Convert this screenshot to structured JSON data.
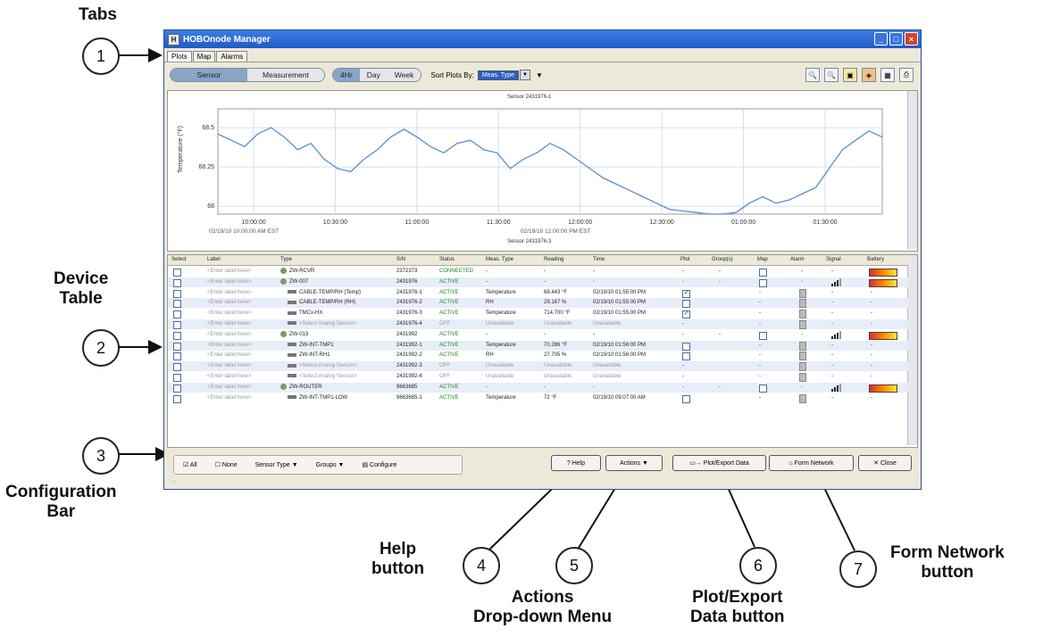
{
  "annotations": {
    "tabs_title": "Tabs",
    "device_table_title": "Device\nTable",
    "config_bar_title": "Configuration\nBar",
    "help_title": "Help\nbutton",
    "actions_title": "Actions\nDrop-down Menu",
    "plot_export_title": "Plot/Export\nData button",
    "form_network_title": "Form Network\nbutton",
    "callouts": [
      "1",
      "2",
      "3",
      "4",
      "5",
      "6",
      "7"
    ]
  },
  "window": {
    "title": "HOBOnode Manager",
    "icon_letter": "H",
    "controls": [
      "_",
      "□",
      "×"
    ]
  },
  "tabs": [
    "Plots",
    "Map",
    "Alarms"
  ],
  "toolbar": {
    "view_segment": [
      "Sensor",
      "Measurement"
    ],
    "range_segment": [
      "4Hr",
      "Day",
      "Week"
    ],
    "sort_label": "Sort Plots By:",
    "sort_value": "Meas. Type",
    "icons": [
      "zoom-in-icon",
      "zoom-out-icon",
      "export-icon",
      "refresh-icon",
      "grid-icon",
      "print-icon"
    ]
  },
  "plot": {
    "sensor_title_top": "Sensor 2431976-1",
    "sensor_title_bottom": "Sensor 2431976-3",
    "ylabel": "Temperature (°F)",
    "yticks": [
      "68.5",
      "68.25",
      "68"
    ],
    "xticks": [
      "10:00:00",
      "10:30:00",
      "11:00:00",
      "11:30:00",
      "12:00:00",
      "12:30:00",
      "01:00:00",
      "01:30:00"
    ],
    "date_left": "02/19/10 10:00:00 AM EST",
    "date_mid": "02/19/10 12:00:00 PM EST",
    "line_color": "#5b8ad9"
  },
  "chart_data": {
    "type": "line",
    "ylabel": "Temperature (°F)",
    "ylim": [
      67.95,
      68.62
    ],
    "x": [
      0,
      2,
      4,
      6,
      8,
      10,
      12,
      14,
      16,
      18,
      20,
      22,
      24,
      26,
      28,
      30,
      32,
      34,
      36,
      38,
      40,
      42,
      44,
      46,
      48,
      50,
      52,
      54,
      56,
      58,
      60,
      62,
      64,
      66,
      68,
      70,
      72,
      74,
      76,
      78,
      80,
      82,
      84,
      86,
      88,
      90,
      92,
      94,
      96,
      98,
      100
    ],
    "series": [
      {
        "values": [
          68.46,
          68.42,
          68.38,
          68.46,
          68.5,
          68.44,
          68.36,
          68.4,
          68.3,
          68.24,
          68.22,
          68.3,
          68.36,
          68.44,
          68.49,
          68.44,
          68.38,
          68.34,
          68.4,
          68.42,
          68.36,
          68.34,
          68.24,
          68.3,
          68.34,
          68.4,
          68.36,
          68.3,
          68.24,
          68.18,
          68.14,
          68.1,
          68.06,
          68.02,
          67.98,
          67.97,
          67.96,
          67.95,
          67.95,
          67.96,
          68.02,
          68.06,
          68.02,
          68.04,
          68.08,
          68.12,
          68.24,
          68.36,
          68.42,
          68.48,
          68.44
        ]
      }
    ]
  },
  "device_table": {
    "columns": [
      "Select",
      "Label",
      "Type",
      "S/N",
      "Status",
      "Meas. Type",
      "Reading",
      "Time",
      "Plot",
      "Group(s)",
      "Map",
      "Alarm",
      "Signal",
      "Battery"
    ],
    "rows": [
      {
        "label": "<Enter label here>",
        "type": "ZW-RCVR",
        "sn": "2372373",
        "status": "CONNECTED",
        "meas": "-",
        "reading": "-",
        "time": "-",
        "plot": "-",
        "groups": "-",
        "map": "box",
        "alarm": "-",
        "signal": "-",
        "battery": "yes"
      },
      {
        "label": "<Enter label here>",
        "type": "ZW-007",
        "sn": "2431976",
        "status": "ACTIVE",
        "meas": "-",
        "reading": "-",
        "time": "-",
        "plot": "-",
        "groups": "-",
        "map": "box",
        "alarm": "-",
        "signal": "bars",
        "battery": "yes"
      },
      {
        "label": "<Enter label here>",
        "type": "CABLE-TEMP/RH (Temp)",
        "sn": "2431976-1",
        "status": "ACTIVE",
        "meas": "Temperature",
        "reading": "68.443 °F",
        "time": "02/19/10 01:55:00 PM",
        "plot": "checked",
        "groups": "",
        "map": "-",
        "alarm": "icon",
        "signal": "-",
        "battery": "-"
      },
      {
        "label": "<Enter label here>",
        "type": "CABLE-TEMP/RH (RH)",
        "sn": "2431976-2",
        "status": "ACTIVE",
        "meas": "RH",
        "reading": "29.167 %",
        "time": "02/19/10 01:55:00 PM",
        "plot": "box",
        "groups": "",
        "map": "-",
        "alarm": "icon",
        "signal": "-",
        "battery": "-"
      },
      {
        "label": "<Enter label here>",
        "type": "TMCx-HX",
        "sn": "2431976-3",
        "status": "ACTIVE",
        "meas": "Temperature",
        "reading": "714.700 °F",
        "time": "02/19/10 01:55:00 PM",
        "plot": "checked",
        "groups": "",
        "map": "-",
        "alarm": "icon",
        "signal": "-",
        "battery": "-"
      },
      {
        "label": "<Enter label here>",
        "type": "<Select Analog Sensor>",
        "sn": "2431976-4",
        "status": "OFF",
        "meas": "Unavailable",
        "reading": "Unavailable",
        "time": "Unavailable",
        "plot": "-",
        "groups": "",
        "map": "-",
        "alarm": "icon",
        "signal": "-",
        "battery": "-"
      },
      {
        "label": "<Enter label here>",
        "type": "ZW-013",
        "sn": "2431992",
        "status": "ACTIVE",
        "meas": "-",
        "reading": "-",
        "time": "-",
        "plot": "-",
        "groups": "-",
        "map": "box",
        "alarm": "-",
        "signal": "bars",
        "battery": "yes"
      },
      {
        "label": "<Enter label here>",
        "type": "ZW-INT-TMP1",
        "sn": "2431992-1",
        "status": "ACTIVE",
        "meas": "Temperature",
        "reading": "70.286 °F",
        "time": "02/19/10 01:56:00 PM",
        "plot": "box",
        "groups": "",
        "map": "-",
        "alarm": "icon",
        "signal": "-",
        "battery": "-"
      },
      {
        "label": "<Enter label here>",
        "type": "ZW-INT-RH1",
        "sn": "2431992-2",
        "status": "ACTIVE",
        "meas": "RH",
        "reading": "27.705 %",
        "time": "02/19/10 01:56:00 PM",
        "plot": "box",
        "groups": "",
        "map": "-",
        "alarm": "icon",
        "signal": "-",
        "battery": "-"
      },
      {
        "label": "<Enter label here>",
        "type": "<Select Analog Sensor>",
        "sn": "2431992-3",
        "status": "OFF",
        "meas": "Unavailable",
        "reading": "Unavailable",
        "time": "Unavailable",
        "plot": "-",
        "groups": "",
        "map": "-",
        "alarm": "icon",
        "signal": "-",
        "battery": "-"
      },
      {
        "label": "<Enter label here>",
        "type": "<Select Analog Sensor>",
        "sn": "2431992-4",
        "status": "OFF",
        "meas": "Unavailable",
        "reading": "Unavailable",
        "time": "Unavailable",
        "plot": "-",
        "groups": "",
        "map": "-",
        "alarm": "icon",
        "signal": "-",
        "battery": "-"
      },
      {
        "label": "<Enter label here>",
        "type": "ZW-ROUTER",
        "sn": "9663685",
        "status": "ACTIVE",
        "meas": "-",
        "reading": "-",
        "time": "-",
        "plot": "-",
        "groups": "-",
        "map": "box",
        "alarm": "-",
        "signal": "bars",
        "battery": "yes"
      },
      {
        "label": "<Enter label here>",
        "type": "ZW-INT-TMP1-LOW",
        "sn": "9663685-1",
        "status": "ACTIVE",
        "meas": "Temperature",
        "reading": "72 °F",
        "time": "02/19/10 09:07:00 AM",
        "plot": "box",
        "groups": "",
        "map": "-",
        "alarm": "icon",
        "signal": "-",
        "battery": "-"
      }
    ]
  },
  "config_bar": {
    "all": "All",
    "none": "None",
    "sensor_type": "Sensor Type ▼",
    "groups": "Groups ▼",
    "configure": "Configure"
  },
  "buttons": {
    "help": "Help",
    "actions": "Actions ▼",
    "plot_export": "Plot/Export Data",
    "form_network": "Form Network",
    "close": "Close"
  }
}
